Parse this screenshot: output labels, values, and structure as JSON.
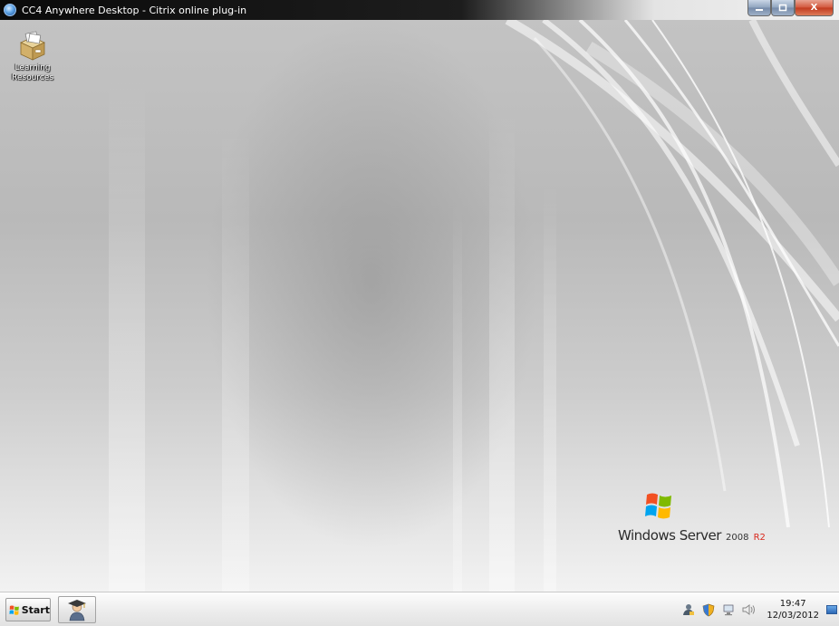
{
  "window": {
    "title": "CC4 Anywhere Desktop - Citrix online plug-in",
    "icon": "citrix-icon",
    "buttons": {
      "minimize": "minimize-icon",
      "maximize": "maximize-icon",
      "close_glyph": "X"
    }
  },
  "desktop": {
    "icons": [
      {
        "label": "Learning\nResources",
        "icon": "learning-resources-box-icon"
      }
    ]
  },
  "branding": {
    "name": "Windows Server",
    "year": "2008",
    "edition": "R2",
    "logo": "windows-flag-logo",
    "edition_color": "#d9281c"
  },
  "taskbar": {
    "start_label": "Start",
    "start_icon": "windows-flag-icon",
    "quick_launch": [
      {
        "icon": "graduate-student-icon"
      }
    ],
    "tray_icons": [
      "user-status-icon",
      "security-shield-icon",
      "network-icon",
      "volume-icon"
    ],
    "clock": {
      "time": "19:47",
      "date": "12/03/2012"
    },
    "show_desktop_icon": "show-desktop-icon"
  },
  "colors": {
    "titlebar_dark": "#0a0a0a",
    "close_button": "#c13a1e",
    "taskbar": "#eeeeee"
  }
}
